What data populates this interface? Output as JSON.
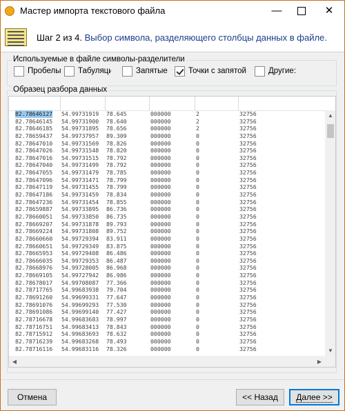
{
  "window": {
    "title": "Мастер импорта текстового файла",
    "buttons": {
      "minimize": "—",
      "close": "✕"
    }
  },
  "header": {
    "step": "Шаг 2 из 4.",
    "description": "Выбор символа, разделяющего столбцы данных в файле."
  },
  "delimiters": {
    "legend": "Используемые в файле символы-разделители",
    "options": [
      {
        "label": "Пробелы",
        "checked": false
      },
      {
        "label": "Табуляции",
        "checked": false
      },
      {
        "label": "Запятые",
        "checked": false
      },
      {
        "label": "Точки с запятой",
        "checked": true
      },
      {
        "label": "Другие:",
        "checked": false
      }
    ]
  },
  "sample": {
    "legend": "Образец разбора данных",
    "rows": [
      [
        "82.78646127",
        "54.99731919",
        "78.645",
        "000000",
        "2",
        "32756"
      ],
      [
        "82.78646145",
        "54.99731900",
        "78.640",
        "000000",
        "2",
        "32756"
      ],
      [
        "82.78646185",
        "54.99731895",
        "78.656",
        "000000",
        "2",
        "32756"
      ],
      [
        "82.78659437",
        "54.99737957",
        "89.309",
        "000000",
        "0",
        "32756"
      ],
      [
        "82.78647010",
        "54.99731569",
        "78.826",
        "000000",
        "0",
        "32756"
      ],
      [
        "82.78647026",
        "54.99731548",
        "78.820",
        "000000",
        "0",
        "32756"
      ],
      [
        "82.78647016",
        "54.99731515",
        "78.792",
        "000000",
        "0",
        "32756"
      ],
      [
        "82.78647040",
        "54.99731499",
        "78.792",
        "000000",
        "0",
        "32756"
      ],
      [
        "82.78647055",
        "54.99731479",
        "78.785",
        "000000",
        "0",
        "32756"
      ],
      [
        "82.78647096",
        "54.99731471",
        "78.799",
        "000000",
        "0",
        "32756"
      ],
      [
        "82.78647119",
        "54.99731455",
        "78.799",
        "000000",
        "0",
        "32756"
      ],
      [
        "82.78647186",
        "54.99731459",
        "78.834",
        "000000",
        "0",
        "32756"
      ],
      [
        "82.78647236",
        "54.99731454",
        "78.855",
        "000000",
        "0",
        "32756"
      ],
      [
        "82.78659887",
        "54.99733895",
        "86.736",
        "000000",
        "0",
        "32756"
      ],
      [
        "82.78660051",
        "54.99733850",
        "86.735",
        "000000",
        "0",
        "32756"
      ],
      [
        "82.78669207",
        "54.99731878",
        "89.793",
        "000000",
        "0",
        "32756"
      ],
      [
        "82.78669224",
        "54.99731808",
        "89.752",
        "000000",
        "0",
        "32756"
      ],
      [
        "82.78660660",
        "54.99729394",
        "83.911",
        "000000",
        "0",
        "32756"
      ],
      [
        "82.78660651",
        "54.99729349",
        "83.875",
        "000000",
        "0",
        "32756"
      ],
      [
        "82.78665953",
        "54.99729408",
        "86.486",
        "000000",
        "0",
        "32756"
      ],
      [
        "82.78666035",
        "54.99729353",
        "86.487",
        "000000",
        "0",
        "32756"
      ],
      [
        "82.78668976",
        "54.99728005",
        "86.968",
        "000000",
        "0",
        "32756"
      ],
      [
        "82.78669105",
        "54.99727942",
        "86.986",
        "000000",
        "0",
        "32756"
      ],
      [
        "82.78678017",
        "54.99708087",
        "77.366",
        "000000",
        "0",
        "32756"
      ],
      [
        "82.78717765",
        "54.99683938",
        "79.704",
        "000000",
        "0",
        "32756"
      ],
      [
        "82.78691260",
        "54.99699331",
        "77.647",
        "000000",
        "0",
        "32756"
      ],
      [
        "82.78691076",
        "54.99699293",
        "77.530",
        "000000",
        "0",
        "32756"
      ],
      [
        "82.78691086",
        "54.99699140",
        "77.427",
        "000000",
        "0",
        "32756"
      ],
      [
        "82.78716678",
        "54.99683683",
        "78.997",
        "000000",
        "0",
        "32756"
      ],
      [
        "82.78716751",
        "54.99683413",
        "78.843",
        "000000",
        "0",
        "32756"
      ],
      [
        "82.78715912",
        "54.99683693",
        "78.632",
        "000000",
        "0",
        "32756"
      ],
      [
        "82.78716239",
        "54.99683268",
        "78.493",
        "000000",
        "0",
        "32756"
      ],
      [
        "82.78716116",
        "54.99683116",
        "78.326",
        "000000",
        "0",
        "32756"
      ]
    ]
  },
  "buttons": {
    "cancel": "Отмена",
    "back": "<< Назад",
    "next": "Далее >>"
  },
  "colors": {
    "accent_border": "#0078d7",
    "selection": "#99c9ef",
    "step_text": "#1a3c8a"
  }
}
